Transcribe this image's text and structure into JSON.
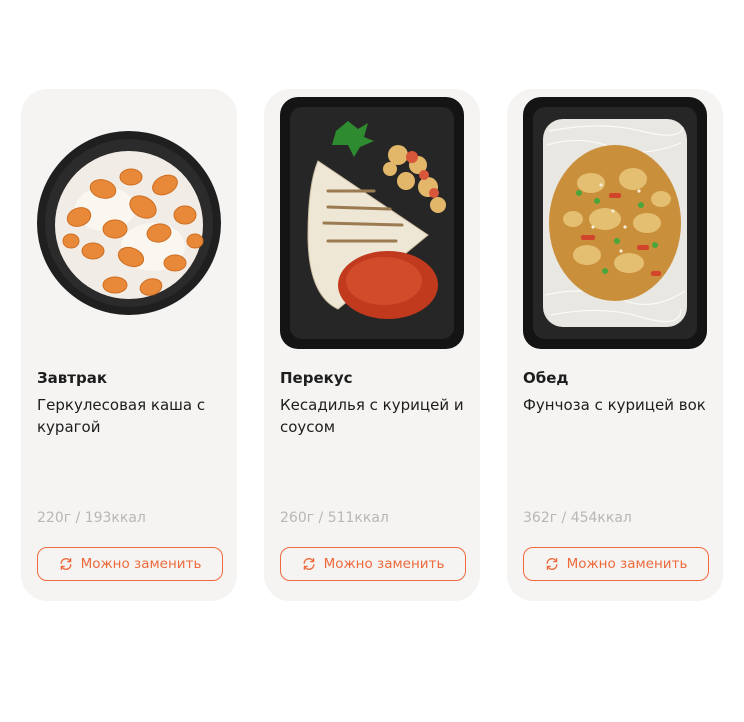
{
  "colors": {
    "accent": "#ee6a3c",
    "card_bg": "#f5f4f2",
    "muted_text": "#b9b7b3"
  },
  "menu": {
    "cards": [
      {
        "meal": "Завтрак",
        "dish": "Геркулесовая каша с курагой",
        "weight": "220г / 193ккал",
        "replace_label": "Можно заменить",
        "image": "oatmeal-with-dried-apricots-bowl"
      },
      {
        "meal": "Перекус",
        "dish": "Кесадилья с курицей и соусом",
        "weight": "260г / 511ккал",
        "replace_label": "Можно заменить",
        "image": "quesadilla-with-chicken-and-sauce-container"
      },
      {
        "meal": "Обед",
        "dish": "Фунчоза с курицей вок",
        "weight": "362г / 454ккал",
        "replace_label": "Можно заменить",
        "image": "funchoza-chicken-wok-container"
      }
    ]
  }
}
